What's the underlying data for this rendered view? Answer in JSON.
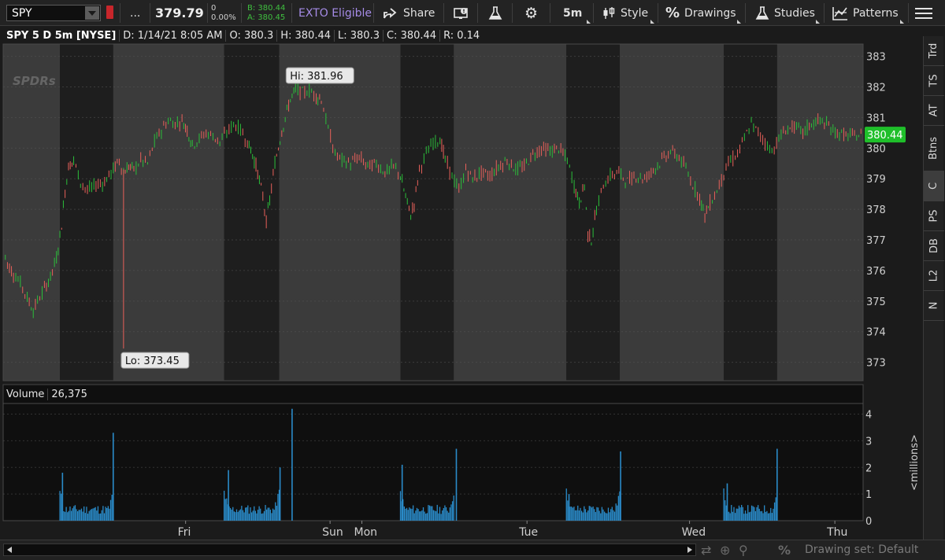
{
  "toolbar": {
    "symbol": "SPY",
    "more": "...",
    "last_price": "379.79",
    "change": "0",
    "change_pct": "0.00%",
    "bid": "B: 380.44",
    "ask": "A: 380.45",
    "exto": "EXTO Eligible",
    "share": "Share",
    "interval": "5m",
    "style": "Style",
    "drawings": "Drawings",
    "studies": "Studies",
    "patterns": "Patterns",
    "colors": {
      "exto": "#a58be6",
      "bid_ask": "#3fbf3f",
      "link_flag": "#c8262b"
    }
  },
  "header": {
    "symbol_desc": "SPY 5 D 5m [NYSE]",
    "date": "D: 1/14/21 8:05 AM",
    "open": "O: 380.3",
    "high": "H: 380.44",
    "low": "L: 380.3",
    "close": "C: 380.44",
    "range": "R: 0.14"
  },
  "volume_header": {
    "label": "Volume",
    "value": "26,375"
  },
  "side_tabs": [
    {
      "label": "Trd"
    },
    {
      "label": "TS"
    },
    {
      "label": "AT"
    },
    {
      "label": "Btns"
    },
    {
      "label": "C",
      "active": true
    },
    {
      "label": "PS"
    },
    {
      "label": "DB"
    },
    {
      "label": "L2"
    },
    {
      "label": "N"
    }
  ],
  "chart_data": {
    "type": "line",
    "symbol": "SPY",
    "price_axis": {
      "ticks": [
        373,
        374,
        375,
        376,
        377,
        378,
        379,
        380,
        381,
        382,
        383
      ],
      "range": [
        372.4,
        383.4
      ]
    },
    "current_price_label": "380.44",
    "hi_label": "Hi: 381.96",
    "lo_label": "Lo: 373.45",
    "x_labels": [
      "Fri",
      "Sun",
      "Mon",
      "Tue",
      "Wed",
      "Thu"
    ],
    "sessions": [
      {
        "day": "Fri-1 pre",
        "shade": "light"
      },
      {
        "day": "Fri-1 regular",
        "shade": "dark"
      },
      {
        "day": "Fri-1 post/overnight",
        "shade": "light"
      },
      {
        "day": "Fri regular",
        "shade": "dark"
      },
      {
        "day": "Fri post",
        "shade": "light"
      },
      {
        "day": "Mon regular",
        "shade": "dark"
      },
      {
        "day": "Mon post/Tue pre",
        "shade": "light"
      },
      {
        "day": "Tue regular",
        "shade": "dark"
      },
      {
        "day": "Tue post/Wed pre",
        "shade": "light"
      },
      {
        "day": "Wed regular",
        "shade": "dark"
      },
      {
        "day": "Wed post/Thu pre",
        "shade": "light"
      }
    ],
    "price_path": [
      [
        0.0,
        376.8
      ],
      [
        0.005,
        376.2
      ],
      [
        0.012,
        375.9
      ],
      [
        0.02,
        375.6
      ],
      [
        0.028,
        375.1
      ],
      [
        0.035,
        374.7
      ],
      [
        0.04,
        375.0
      ],
      [
        0.048,
        375.4
      ],
      [
        0.055,
        375.8
      ],
      [
        0.062,
        376.4
      ],
      [
        0.068,
        377.5
      ],
      [
        0.072,
        378.6
      ],
      [
        0.076,
        379.4
      ],
      [
        0.082,
        379.6
      ],
      [
        0.09,
        378.9
      ],
      [
        0.098,
        378.6
      ],
      [
        0.108,
        378.8
      ],
      [
        0.118,
        378.9
      ],
      [
        0.128,
        379.3
      ],
      [
        0.135,
        379.6
      ],
      [
        0.14,
        379.2
      ],
      [
        0.146,
        379.4
      ],
      [
        0.152,
        379.3
      ],
      [
        0.16,
        379.6
      ],
      [
        0.168,
        379.5
      ],
      [
        0.176,
        380.2
      ],
      [
        0.184,
        380.6
      ],
      [
        0.192,
        380.9
      ],
      [
        0.2,
        380.8
      ],
      [
        0.208,
        380.9
      ],
      [
        0.214,
        380.6
      ],
      [
        0.22,
        380.1
      ],
      [
        0.228,
        380.3
      ],
      [
        0.236,
        380.5
      ],
      [
        0.244,
        380.4
      ],
      [
        0.252,
        380.2
      ],
      [
        0.26,
        380.5
      ],
      [
        0.268,
        380.8
      ],
      [
        0.276,
        380.6
      ],
      [
        0.284,
        380.2
      ],
      [
        0.29,
        379.8
      ],
      [
        0.296,
        379.2
      ],
      [
        0.302,
        378.4
      ],
      [
        0.306,
        377.6
      ],
      [
        0.31,
        378.3
      ],
      [
        0.316,
        379.5
      ],
      [
        0.322,
        380.3
      ],
      [
        0.328,
        381.0
      ],
      [
        0.334,
        381.6
      ],
      [
        0.34,
        381.9
      ],
      [
        0.348,
        381.8
      ],
      [
        0.356,
        381.9
      ],
      [
        0.364,
        381.7
      ],
      [
        0.37,
        381.6
      ],
      [
        0.378,
        380.6
      ],
      [
        0.386,
        379.8
      ],
      [
        0.394,
        379.6
      ],
      [
        0.404,
        379.5
      ],
      [
        0.414,
        379.7
      ],
      [
        0.424,
        379.4
      ],
      [
        0.434,
        379.5
      ],
      [
        0.444,
        379.2
      ],
      [
        0.454,
        379.4
      ],
      [
        0.462,
        379.1
      ],
      [
        0.468,
        378.4
      ],
      [
        0.474,
        377.8
      ],
      [
        0.478,
        378.2
      ],
      [
        0.484,
        379.3
      ],
      [
        0.492,
        379.8
      ],
      [
        0.5,
        380.2
      ],
      [
        0.508,
        380.3
      ],
      [
        0.514,
        379.6
      ],
      [
        0.522,
        379.1
      ],
      [
        0.53,
        378.6
      ],
      [
        0.538,
        379.3
      ],
      [
        0.546,
        379.0
      ],
      [
        0.556,
        379.2
      ],
      [
        0.566,
        379.1
      ],
      [
        0.576,
        379.4
      ],
      [
        0.586,
        379.6
      ],
      [
        0.596,
        379.3
      ],
      [
        0.606,
        379.4
      ],
      [
        0.616,
        379.8
      ],
      [
        0.626,
        380.0
      ],
      [
        0.636,
        379.9
      ],
      [
        0.646,
        380.0
      ],
      [
        0.656,
        379.6
      ],
      [
        0.664,
        378.8
      ],
      [
        0.67,
        378.2
      ],
      [
        0.676,
        378.8
      ],
      [
        0.68,
        377.2
      ],
      [
        0.684,
        377.0
      ],
      [
        0.69,
        378.0
      ],
      [
        0.698,
        378.8
      ],
      [
        0.706,
        379.1
      ],
      [
        0.716,
        379.2
      ],
      [
        0.726,
        378.9
      ],
      [
        0.736,
        379.1
      ],
      [
        0.746,
        379.0
      ],
      [
        0.756,
        379.3
      ],
      [
        0.766,
        379.6
      ],
      [
        0.776,
        379.9
      ],
      [
        0.786,
        379.7
      ],
      [
        0.794,
        379.3
      ],
      [
        0.802,
        378.8
      ],
      [
        0.81,
        378.4
      ],
      [
        0.816,
        377.8
      ],
      [
        0.822,
        378.2
      ],
      [
        0.83,
        378.6
      ],
      [
        0.838,
        379.2
      ],
      [
        0.846,
        379.6
      ],
      [
        0.854,
        379.8
      ],
      [
        0.862,
        380.3
      ],
      [
        0.87,
        380.8
      ],
      [
        0.878,
        380.5
      ],
      [
        0.886,
        380.2
      ],
      [
        0.894,
        379.9
      ],
      [
        0.902,
        380.3
      ],
      [
        0.91,
        380.6
      ],
      [
        0.92,
        380.7
      ],
      [
        0.93,
        380.5
      ],
      [
        0.94,
        380.8
      ],
      [
        0.95,
        380.9
      ],
      [
        0.96,
        380.7
      ],
      [
        0.97,
        380.5
      ],
      [
        0.98,
        380.4
      ],
      [
        0.99,
        380.4
      ],
      [
        1.0,
        380.44
      ]
    ],
    "volume_axis": {
      "ticks": [
        0,
        1,
        2,
        3,
        4
      ],
      "unit_label": "<millions>"
    },
    "volume_spikes": [
      {
        "x": 0.069,
        "v": 1.8
      },
      {
        "x": 0.128,
        "v": 3.3
      },
      {
        "x": 0.262,
        "v": 1.9
      },
      {
        "x": 0.322,
        "v": 2.0
      },
      {
        "x": 0.336,
        "v": 4.2
      },
      {
        "x": 0.464,
        "v": 2.1
      },
      {
        "x": 0.527,
        "v": 2.7
      },
      {
        "x": 0.658,
        "v": 1.0
      },
      {
        "x": 0.718,
        "v": 2.6
      },
      {
        "x": 0.842,
        "v": 1.4
      },
      {
        "x": 0.9,
        "v": 2.7
      }
    ]
  },
  "bottom": {
    "drawing_set": "Drawing set: Default"
  }
}
